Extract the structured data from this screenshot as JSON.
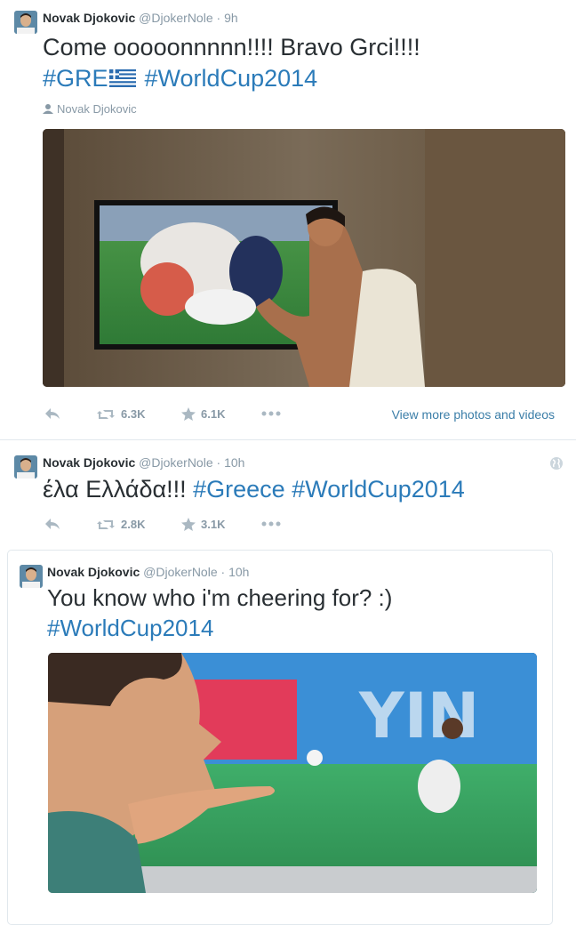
{
  "tweets": [
    {
      "name": "Novak Djokovic",
      "handle": "@DjokerNole",
      "separator": "·",
      "time": "9h",
      "text_line1": "Come ooooonnnnn!!!! Bravo Grci!!!!",
      "hashtag1": "#GRE",
      "hashtag2": "#WorldCup2014",
      "media_context": "Novak Djokovic",
      "retweets": "6.3K",
      "favorites": "6.1K",
      "view_more": "View more photos and videos"
    },
    {
      "name": "Novak Djokovic",
      "handle": "@DjokerNole",
      "separator": "·",
      "time": "10h",
      "text_plain": "έλα Ελλάδα!!!",
      "hashtag1": "#Greece",
      "hashtag2": "#WorldCup2014",
      "retweets": "2.8K",
      "favorites": "3.1K"
    },
    {
      "name": "Novak Djokovic",
      "handle": "@DjokerNole",
      "separator": "·",
      "time": "10h",
      "text_line1": "You know who i'm cheering for? :)",
      "hashtag1": "#WorldCup2014"
    }
  ],
  "icons": {
    "reply": "reply-icon",
    "retweet": "retweet-icon",
    "favorite": "star-icon",
    "more": "more-dots-icon",
    "globe": "globe-icon",
    "person": "person-icon"
  },
  "colors": {
    "link": "#2b7bb9",
    "muted": "#8899a6",
    "text": "#292f33"
  }
}
